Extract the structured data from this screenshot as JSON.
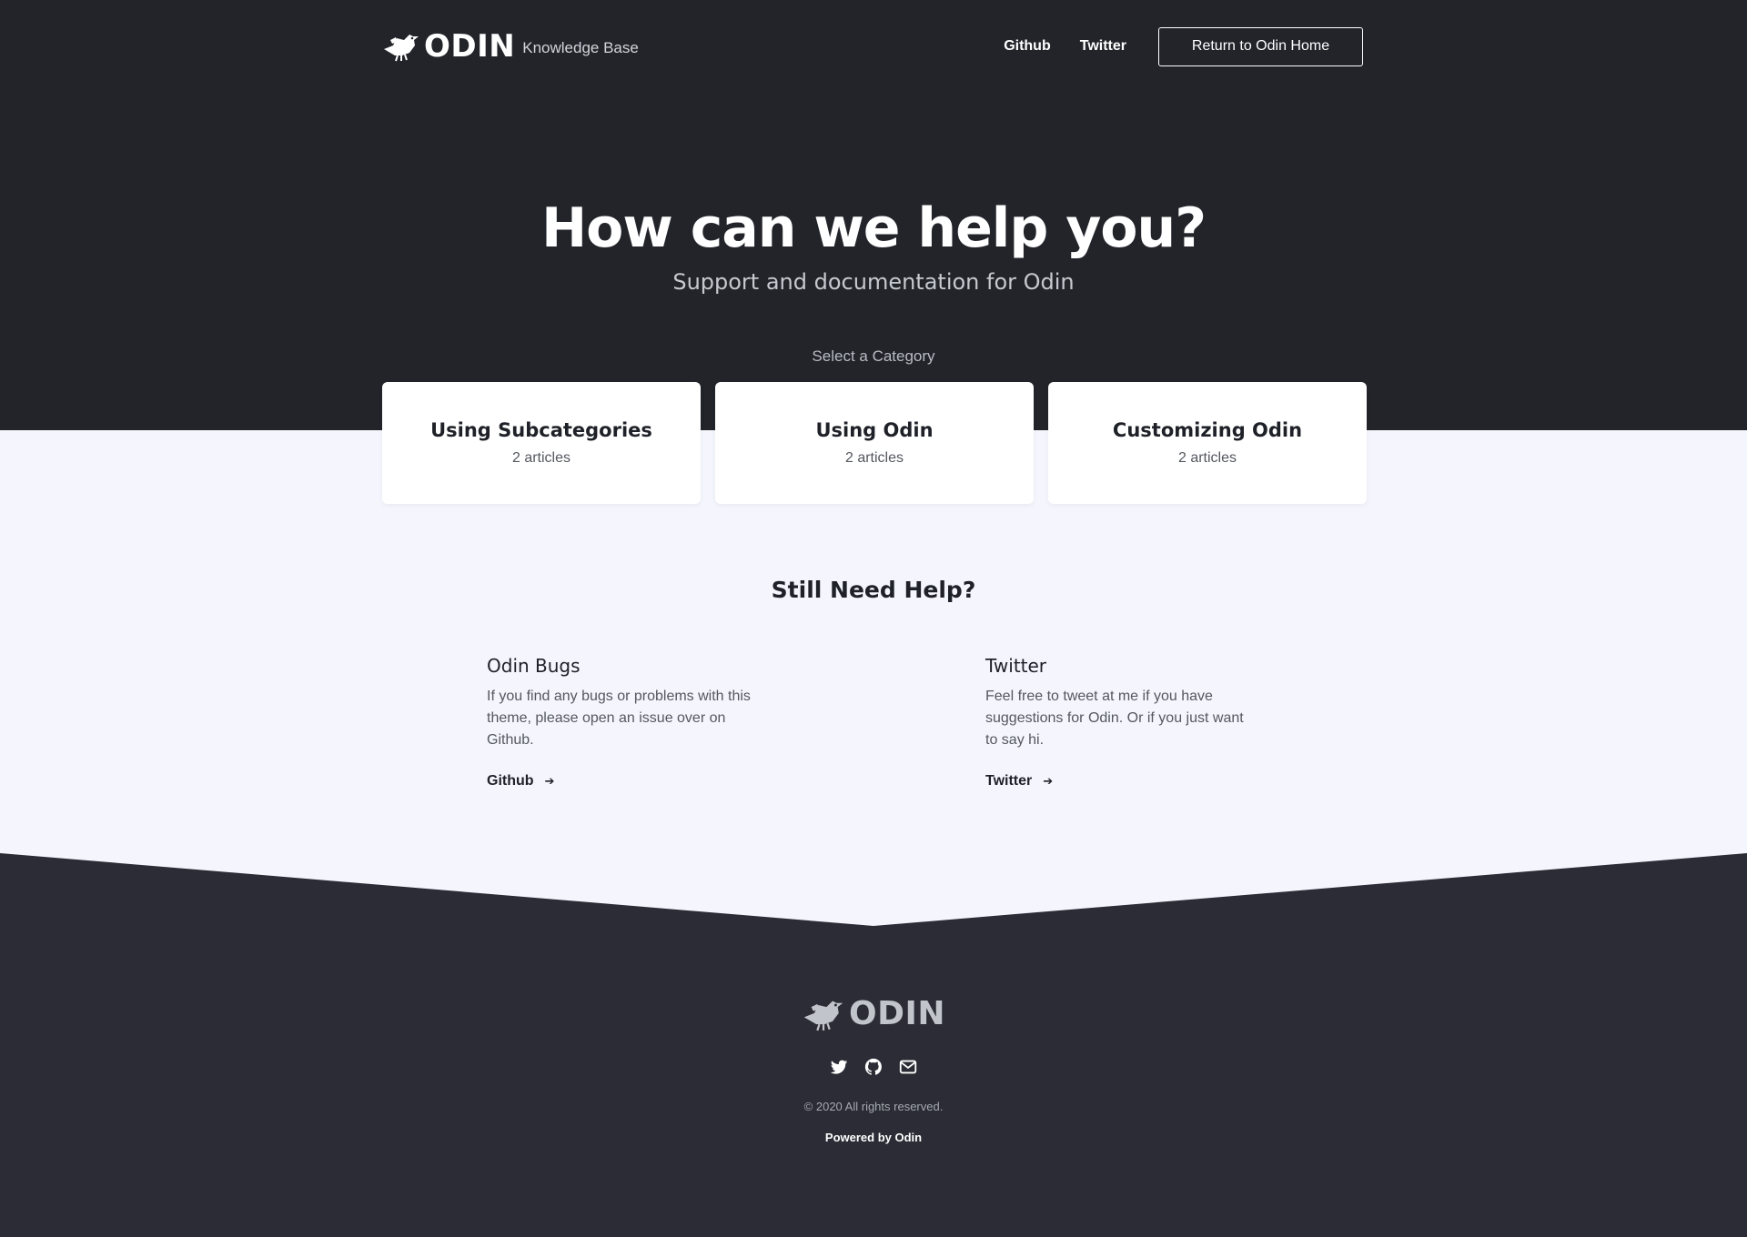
{
  "header": {
    "logo_word": "ODIN",
    "subtitle": "Knowledge Base",
    "logo_icon": "raven-logo-icon",
    "nav": [
      {
        "label": "Github"
      },
      {
        "label": "Twitter"
      }
    ],
    "home_button": "Return to Odin Home"
  },
  "hero": {
    "title": "How can we help you?",
    "subtitle": "Support and documentation for Odin",
    "select_label": "Select a Category"
  },
  "categories": [
    {
      "title": "Using Subcategories",
      "count": "2 articles"
    },
    {
      "title": "Using Odin",
      "count": "2 articles"
    },
    {
      "title": "Customizing Odin",
      "count": "2 articles"
    }
  ],
  "help": {
    "title": "Still Need Help?",
    "columns": [
      {
        "title": "Odin Bugs",
        "description": "If you find any bugs or problems with this theme, please open an issue over on Github.",
        "link": "Github",
        "link_icon": "arrow-right-icon"
      },
      {
        "title": "Twitter",
        "description": "Feel free to tweet at me if you have suggestions for Odin. Or if you just want to say hi.",
        "link": "Twitter",
        "link_icon": "arrow-right-icon"
      }
    ]
  },
  "footer": {
    "logo_word": "ODIN",
    "social_icons": [
      "twitter-icon",
      "github-icon",
      "mail-icon"
    ],
    "copyright": "© 2020 All rights reserved.",
    "powered": "Powered by Odin"
  },
  "colors": {
    "hero_bg": "#22242a",
    "middle_bg": "#f5f6fd",
    "footer_bg": "#2b2c35",
    "text_dark": "#1f2128",
    "text_muted": "#55585f"
  }
}
